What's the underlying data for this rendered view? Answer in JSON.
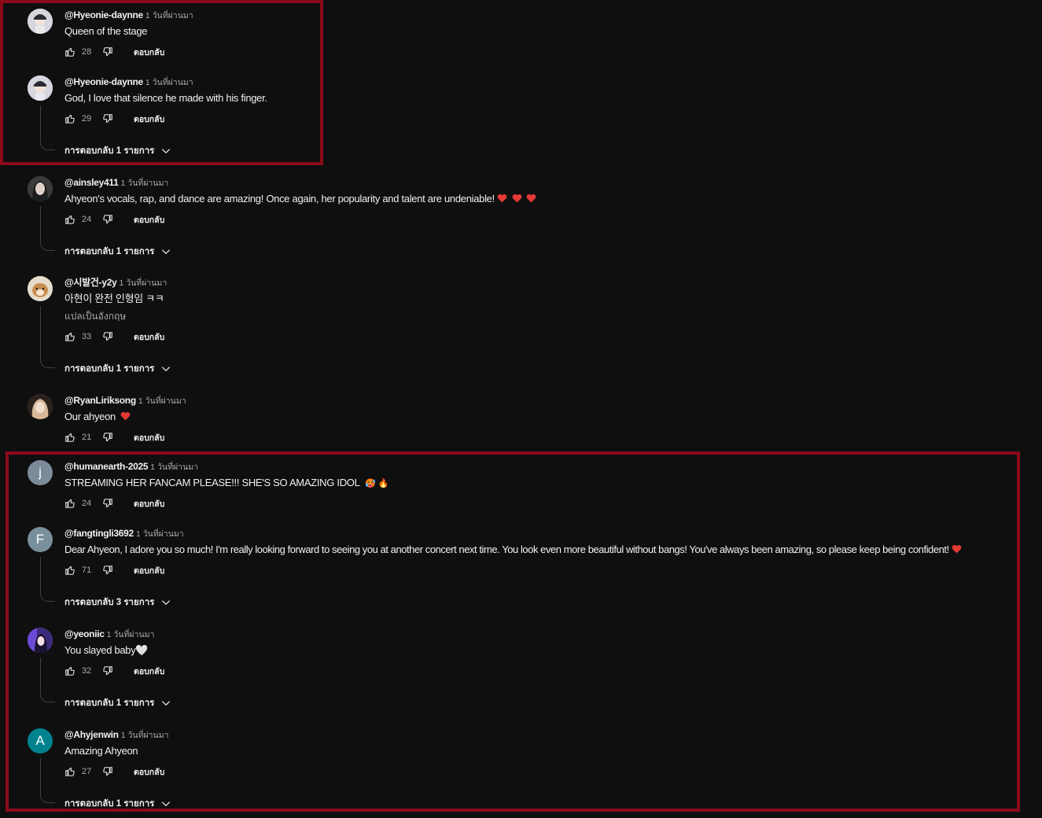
{
  "labels": {
    "reply": "ตอบกลับ"
  },
  "comments": [
    {
      "handle": "@Hyeonie-daynne",
      "time": "1 วันที่ผ่านมา",
      "text": "Queen of the stage",
      "likes": "28",
      "avatar_type": "photo",
      "avatar_color": "#c9c9d4"
    },
    {
      "handle": "@Hyeonie-daynne",
      "time": "1 วันที่ผ่านมา",
      "text": "God, I love that silence he made with his finger.",
      "likes": "29",
      "replies": "การตอบกลับ 1 รายการ",
      "avatar_type": "photo",
      "avatar_color": "#c9c9d4"
    },
    {
      "handle": "@ainsley411",
      "time": "1 วันที่ผ่านมา",
      "text": "Ahyeon's vocals, rap, and dance are amazing! Once again, her popularity and talent are undeniable!",
      "likes": "24",
      "replies": "การตอบกลับ 1 รายการ",
      "hearts": 3,
      "avatar_type": "photo",
      "avatar_color": "#5a5a5a"
    },
    {
      "handle": "@시발건-y2y",
      "time": "1 วันที่ผ่านมา",
      "text": "아현이 완전 인형임 ㅋㅋ",
      "translate": "แปลเป็นอังกฤษ",
      "likes": "33",
      "replies": "การตอบกลับ 1 รายการ",
      "avatar_type": "photo",
      "avatar_color": "#b98a5a"
    },
    {
      "handle": "@RyanLiriksong",
      "time": "1 วันที่ผ่านมา",
      "text": "Our ahyeon",
      "likes": "21",
      "hearts": 1,
      "avatar_type": "photo",
      "avatar_color": "#8a6f66"
    },
    {
      "handle": "@humanearth-2025",
      "time": "1 วันที่ผ่านมา",
      "text": "STREAMING HER FANCAM PLEASE!!! SHE'S SO AMAZING IDOL",
      "emoji": "🥵 🔥",
      "likes": "24",
      "avatar_type": "letter",
      "letter": "j",
      "avatar_color": "#7c8b99"
    },
    {
      "handle": "@fangtingli3692",
      "time": "1 วันที่ผ่านมา",
      "text": "Dear Ahyeon, I adore you so much! I'm really looking forward to seeing you at another concert next time. You look even more beautiful without bangs! You've always been amazing, so please keep being confident!",
      "likes": "71",
      "replies": "การตอบกลับ 3 รายการ",
      "hearts": 1,
      "avatar_type": "letter",
      "letter": "F",
      "avatar_color": "#78909c"
    },
    {
      "handle": "@yeoniic",
      "time": "1 วันที่ผ่านมา",
      "text": "You slayed baby🤍",
      "likes": "32",
      "replies": "การตอบกลับ 1 รายการ",
      "avatar_type": "photo",
      "avatar_color": "#c48fd8"
    },
    {
      "handle": "@Ahyjenwin",
      "time": "1 วันที่ผ่านมา",
      "text": "Amazing Ahyeon",
      "likes": "27",
      "replies": "การตอบกลับ 1 รายการ",
      "avatar_type": "letter",
      "letter": "A",
      "avatar_color": "#00838f"
    }
  ],
  "colors": {
    "background": "#0f0f0f",
    "highlight": "#8b0a1a",
    "heart": "#e53935"
  }
}
